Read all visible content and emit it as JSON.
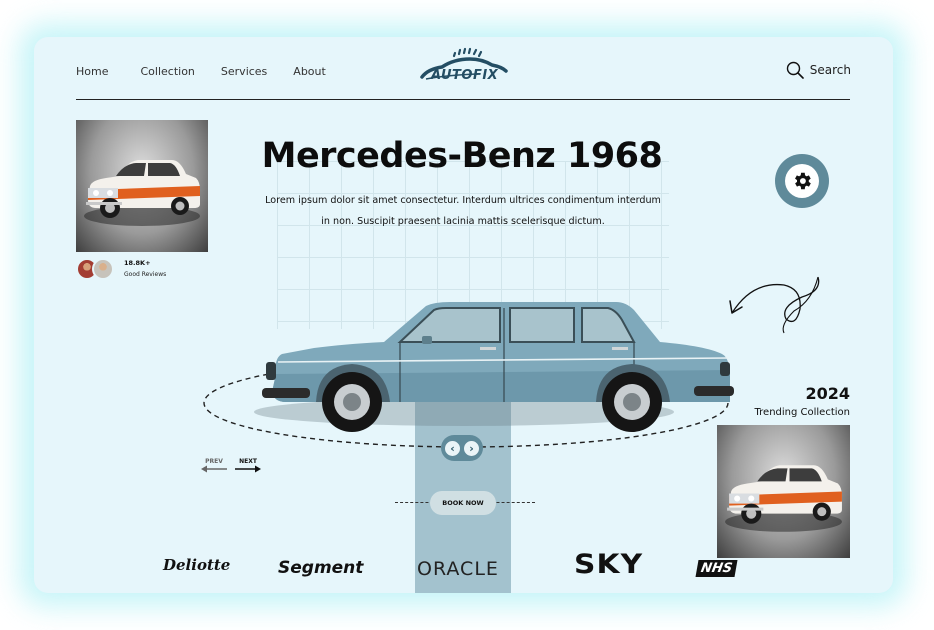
{
  "nav": {
    "items": [
      "Home",
      "Collection",
      "Services",
      "About"
    ],
    "search_label": "Search"
  },
  "logo": {
    "auto": "AUTO",
    "fix": "FIX"
  },
  "hero": {
    "title": "Mercedes-Benz 1968",
    "description": "Lorem ipsum dolor sit amet consectetur. Interdum ultrices condimentum interdum in non. Suscipit praesent lacinia mattis scelerisque dictum."
  },
  "reviews": {
    "count": "18.8K+",
    "label": "Good Reviews"
  },
  "trending": {
    "year": "2024",
    "label": "Trending Collection"
  },
  "controls": {
    "prev": "PREV",
    "next": "NEXT",
    "book_now": "BOOK NOW"
  },
  "brands": [
    "Deliotte",
    "Segment",
    "ORACLE",
    "SKY",
    "NHS"
  ],
  "colors": {
    "background": "#e6f6fb",
    "accent": "#5f8a9a",
    "strip": "#a3c2ce",
    "car_body": "#7fa9bb",
    "vintage_car": "#e0601f"
  },
  "icons": [
    "search-icon",
    "gear-icon",
    "chevron-left-icon",
    "chevron-right-icon",
    "curved-arrow-icon",
    "arrow-left-icon",
    "arrow-right-icon"
  ]
}
